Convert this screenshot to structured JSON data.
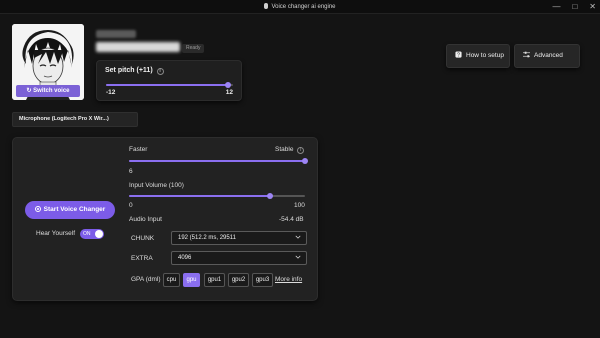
{
  "window": {
    "title": "Voice changer ai engine",
    "controls": [
      "minimize-icon",
      "maximize-icon",
      "close-icon"
    ]
  },
  "voice": {
    "name_blurred": "",
    "badge": "Ready",
    "switch_label": "Switch voice"
  },
  "pitch": {
    "label": "Set pitch (+11)",
    "min": "-12",
    "max": "12",
    "value": 11
  },
  "header_buttons": {
    "setup_label": "How to setup",
    "advanced_label": "Advanced"
  },
  "microphone": {
    "label": "Microphone (Logitech Pro X Wir...)"
  },
  "controls": {
    "start_label": "Start Voice Changer",
    "hear_yourself_label": "Hear Yourself",
    "hear_toggle": "ON",
    "speed": {
      "left": "Faster",
      "right": "Stable",
      "value_label": "6",
      "fraction": 1.0
    },
    "input_volume": {
      "label": "Input Volume (100)",
      "min": "0",
      "max": "100",
      "fraction": 0.8
    },
    "audio_input": {
      "label": "Audio Input",
      "value": "-54.4 dB"
    },
    "chunk": {
      "label": "CHUNK",
      "value": "192 (512.2 ms, 29511"
    },
    "extra": {
      "label": "EXTRA",
      "value": "4096"
    },
    "gpa": {
      "label": "GPA (dml)",
      "options": [
        "cpu",
        "gpu",
        "gpu1",
        "gpu2",
        "gpu3"
      ],
      "selected": "gpu",
      "more_info": "More info"
    }
  },
  "colors": {
    "accent": "#7c5ce8",
    "background": "#141414",
    "card": "#222222"
  }
}
